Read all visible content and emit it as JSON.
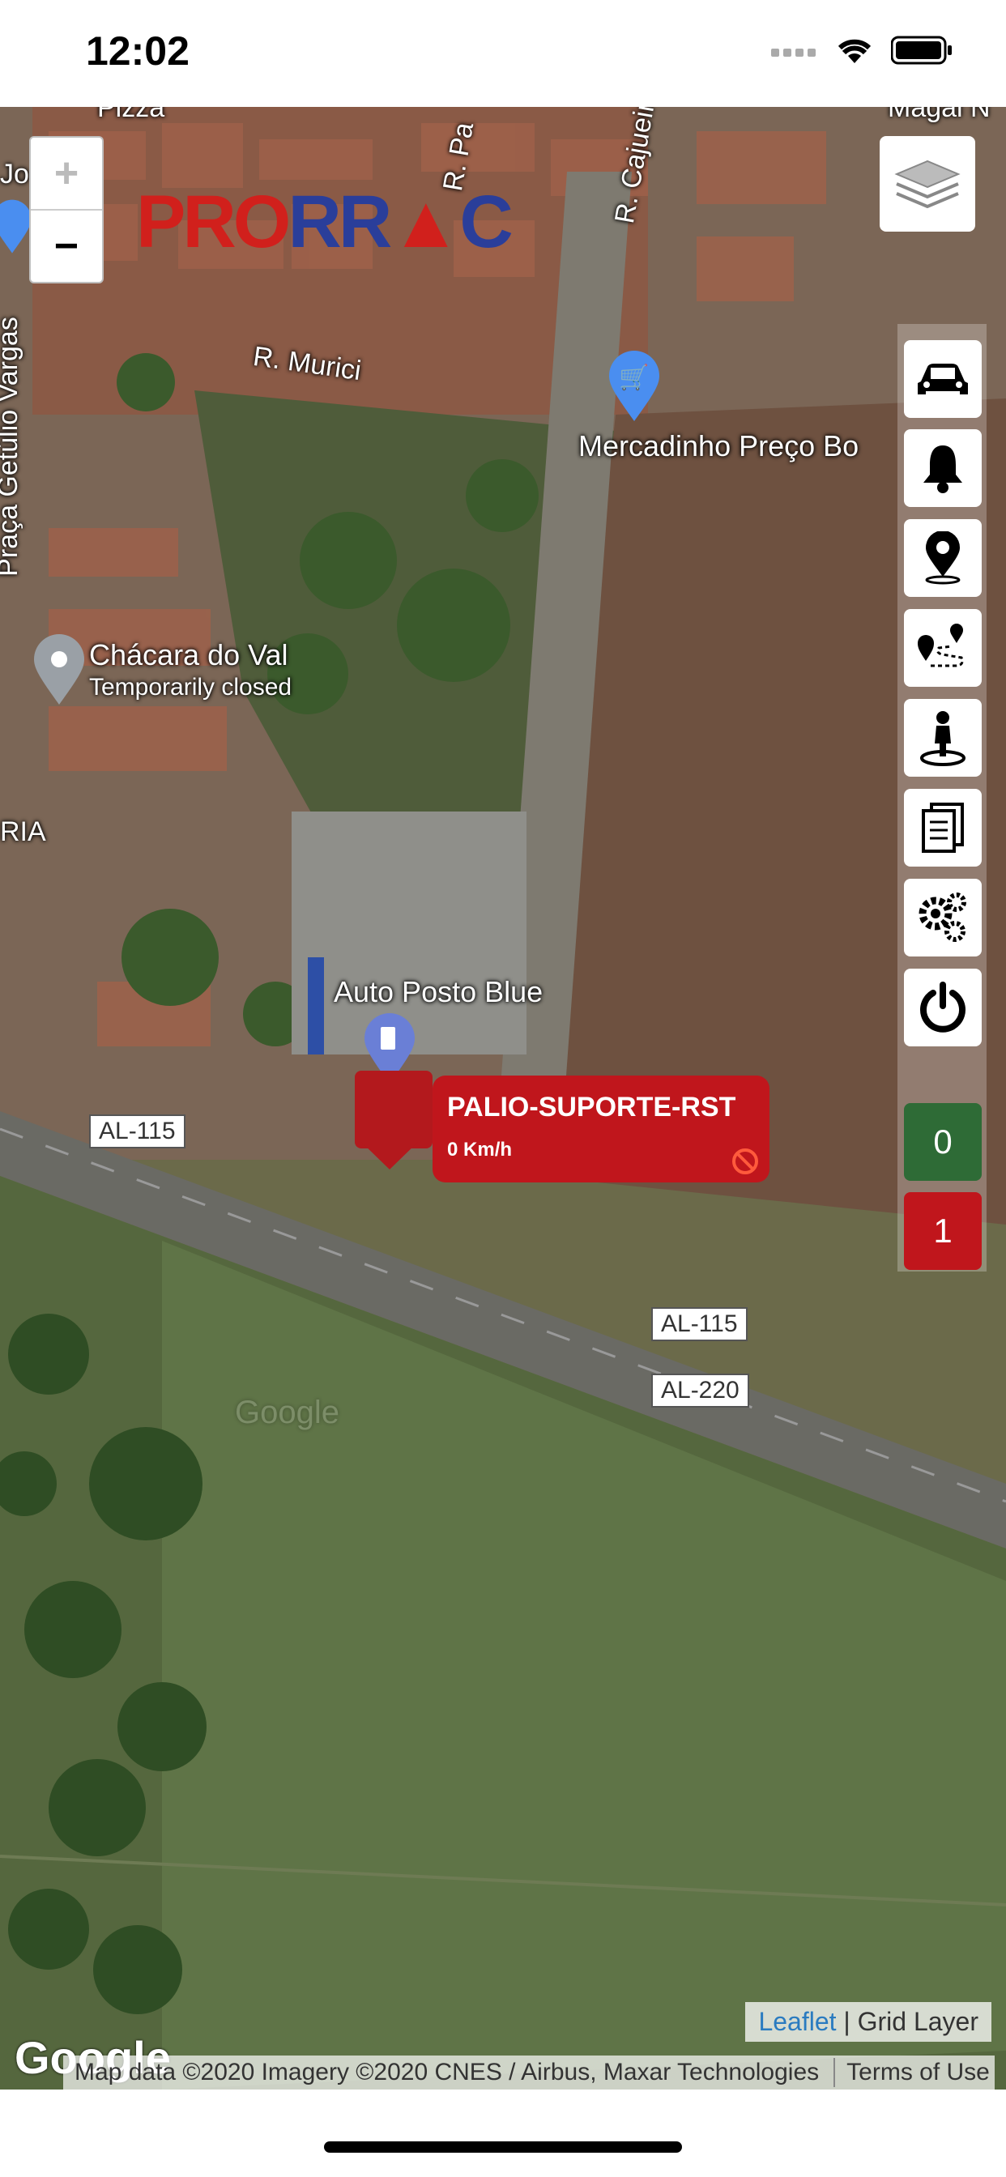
{
  "status": {
    "time": "12:02"
  },
  "map": {
    "logo": "PRORRAC",
    "zoom_in": "+",
    "zoom_out": "−",
    "streets": [
      "R. Murici",
      "R. Cajueiro",
      "R. Pa",
      "Praça Getúlio Vargas",
      "RIA",
      "Jo",
      "Magal N",
      "Pizza"
    ],
    "pois": {
      "mercadinho": "Mercadinho Preço Bo",
      "chacara": "Chácara do Val",
      "chacara_status": "Temporarily closed",
      "auto_posto": "Auto Posto Blue"
    },
    "shields": [
      "AL-115",
      "AL-115",
      "AL-220"
    ],
    "watermark": "Google"
  },
  "side_buttons": [
    {
      "icon": "car-icon"
    },
    {
      "icon": "bell-icon"
    },
    {
      "icon": "location-pin-icon"
    },
    {
      "icon": "route-icon"
    },
    {
      "icon": "person-location-icon"
    },
    {
      "icon": "document-icon"
    },
    {
      "icon": "settings-gears-icon"
    },
    {
      "icon": "power-icon"
    }
  ],
  "counters": {
    "online": "0",
    "offline": "1",
    "colors": {
      "online": "#2e6b36",
      "offline": "#c0161c"
    }
  },
  "vehicle": {
    "name": "PALIO-SUPORTE-RST",
    "speed": "0 Km/h"
  },
  "attribution": {
    "leaflet": "Leaflet",
    "layer": "Grid Layer",
    "map_data": "Map data ©2020 Imagery ©2020 CNES / Airbus, Maxar Technologies",
    "terms": "Terms of Use",
    "google": "Google"
  }
}
